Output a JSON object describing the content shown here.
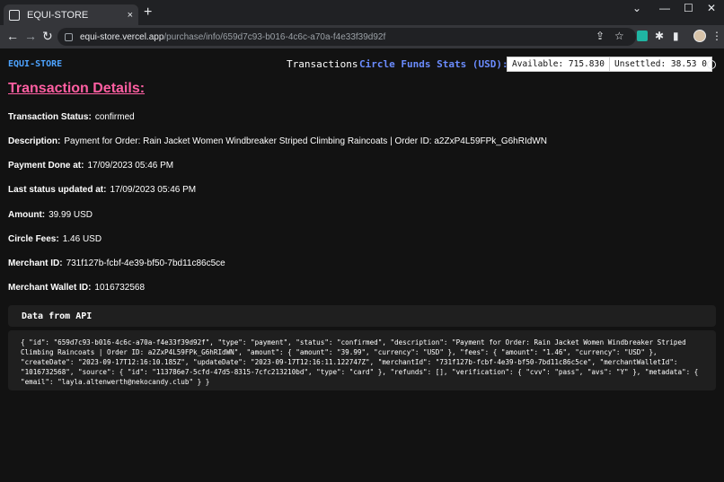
{
  "browser": {
    "tab_title": "EQUI-STORE",
    "tab_close": "×",
    "new_tab": "+",
    "url_host": "equi-store.vercel.app",
    "url_path": "/purchase/info/659d7c93-b016-4c6c-a70a-f4e33f39d92f",
    "icons": [
      "back-icon",
      "forward-icon",
      "reload-icon",
      "lock-icon",
      "share-icon",
      "star-icon",
      "extension-icon",
      "puzzle-icon",
      "sidebar-icon",
      "profile-avatar",
      "menu-icon"
    ]
  },
  "header": {
    "brand": "EQUI-STORE",
    "nav_transactions": "Transactions",
    "nav_stats": "Circle Funds Stats (USD):",
    "available": "Available: 715.830",
    "unsettled": "Unsettled: 38.53 0"
  },
  "main": {
    "title": "Transaction Details:",
    "fields": [
      {
        "label": "Transaction Status:",
        "value": "confirmed"
      },
      {
        "label": "Description:",
        "value": "Payment for Order: Rain Jacket Women Windbreaker Striped Climbing Raincoats | Order ID: a2ZxP4L59FPk_G6hRIdWN"
      },
      {
        "label": "Payment Done at:",
        "value": "17/09/2023 05:46 PM"
      },
      {
        "label": "Last status updated at:",
        "value": "17/09/2023 05:46 PM"
      },
      {
        "label": "Amount:",
        "value": "39.99 USD"
      },
      {
        "label": "Circle Fees:",
        "value": "1.46 USD"
      },
      {
        "label": "Merchant ID:",
        "value": "731f127b-fcbf-4e39-bf50-7bd11c86c5ce"
      },
      {
        "label": "Merchant Wallet ID:",
        "value": "1016732568"
      }
    ],
    "api_title": "Data from API",
    "api_json": "{ \"id\": \"659d7c93-b016-4c6c-a70a-f4e33f39d92f\", \"type\": \"payment\", \"status\": \"confirmed\", \"description\": \"Payment for Order: Rain Jacket Women Windbreaker Striped Climbing Raincoats | Order ID: a2ZxP4L59FPk_G6hRIdWN\", \"amount\": { \"amount\": \"39.99\", \"currency\": \"USD\" }, \"fees\": { \"amount\": \"1.46\", \"currency\": \"USD\" }, \"createDate\": \"2023-09-17T12:16:10.185Z\", \"updateDate\": \"2023-09-17T12:16:11.122747Z\", \"merchantId\": \"731f127b-fcbf-4e39-bf50-7bd11c86c5ce\", \"merchantWalletId\": \"1016732568\", \"source\": { \"id\": \"113786e7-5cfd-47d5-8315-7cfc213210bd\", \"type\": \"card\" }, \"refunds\": [], \"verification\": { \"cvv\": \"pass\", \"avs\": \"Y\" }, \"metadata\": { \"email\": \"layla.altenwerth@nekocandy.club\" } }"
  }
}
